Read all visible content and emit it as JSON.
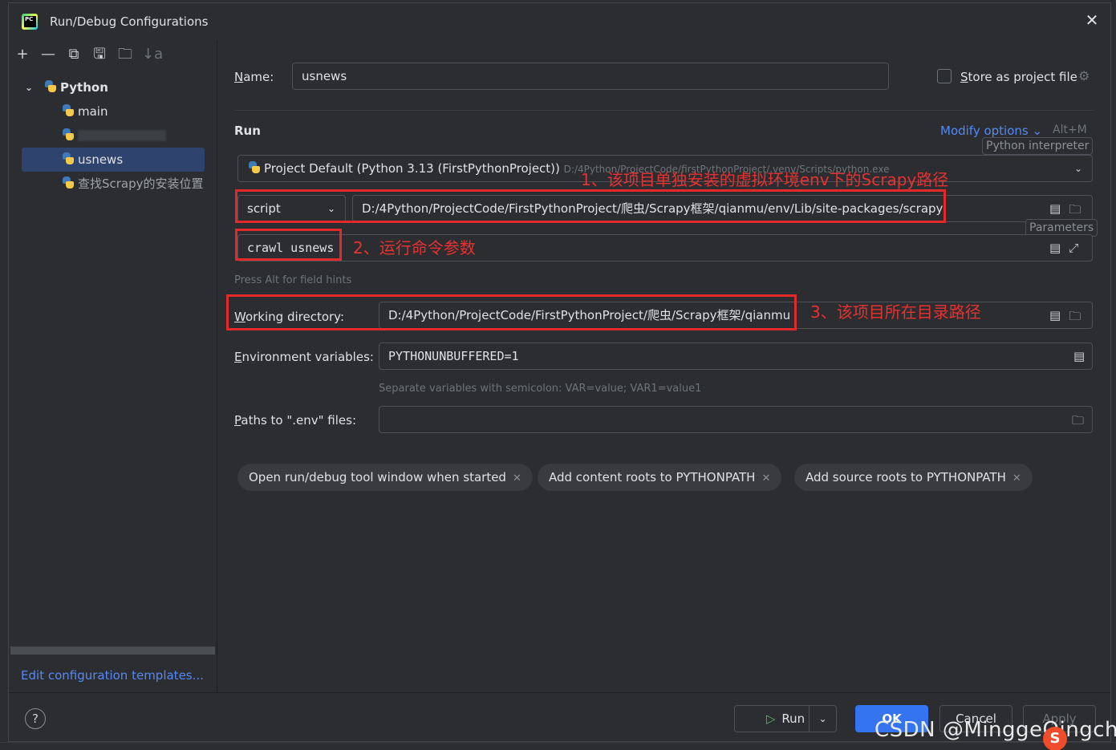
{
  "window": {
    "title": "Run/Debug Configurations"
  },
  "toolbar": {
    "add": "+",
    "remove": "—",
    "copy": "⧉",
    "save": "🖫",
    "folder": "🗀",
    "sort": "↓a"
  },
  "tree": {
    "group": "Python",
    "items": [
      {
        "label": "main"
      },
      {
        "label": ""
      },
      {
        "label": "usnews"
      },
      {
        "label": "查找Scrapy的安装位置"
      }
    ]
  },
  "edit_templates": "Edit configuration templates...",
  "form": {
    "name_label": "Name:",
    "name_value": "usnews",
    "store_label": "Store as project file",
    "run_section": "Run",
    "modify_options": "Modify options ⌄",
    "modify_shortcut": "Alt+M",
    "interpreter_tag": "Python interpreter",
    "interpreter_name": "Project Default (Python 3.13 (FirstPythonProject))",
    "interpreter_path": "D:/4Python/ProjectCode/firstPythonProject/.venv/Scripts/python.exe",
    "script_type": "script",
    "script_path": "D:/4Python/ProjectCode/FirstPythonProject/爬虫/Scrapy框架/qianmu/env/Lib/site-packages/scrapy",
    "parameters_tag": "Parameters",
    "parameters_value": "crawl usnews",
    "field_hint": "Press Alt for field hints",
    "workdir_label": "Working directory:",
    "workdir_value": "D:/4Python/ProjectCode/FirstPythonProject/爬虫/Scrapy框架/qianmu",
    "env_label": "Environment variables:",
    "env_value": "PYTHONUNBUFFERED=1",
    "env_hint": "Separate variables with semicolon: VAR=value; VAR1=value1",
    "dotenv_label": "Paths to \".env\" files:",
    "dotenv_value": ""
  },
  "chips": [
    "Open run/debug tool window when started",
    "Add content roots to PYTHONPATH",
    "Add source roots to PYTHONPATH"
  ],
  "annotations": {
    "a1": "1、该项目单独安装的虚拟环境env下的Scrapy路径",
    "a2": "2、运行命令参数",
    "a3": "3、该项目所在目录路径"
  },
  "buttons": {
    "help": "?",
    "run": "Run",
    "ok": "OK",
    "cancel": "Cancel",
    "apply": "Apply"
  },
  "watermark": "CSDN @MinggeQingchun",
  "colors": {
    "accent": "#3574f0",
    "link": "#548af7",
    "annotation": "#e22a2a",
    "selection": "#2e436e"
  }
}
